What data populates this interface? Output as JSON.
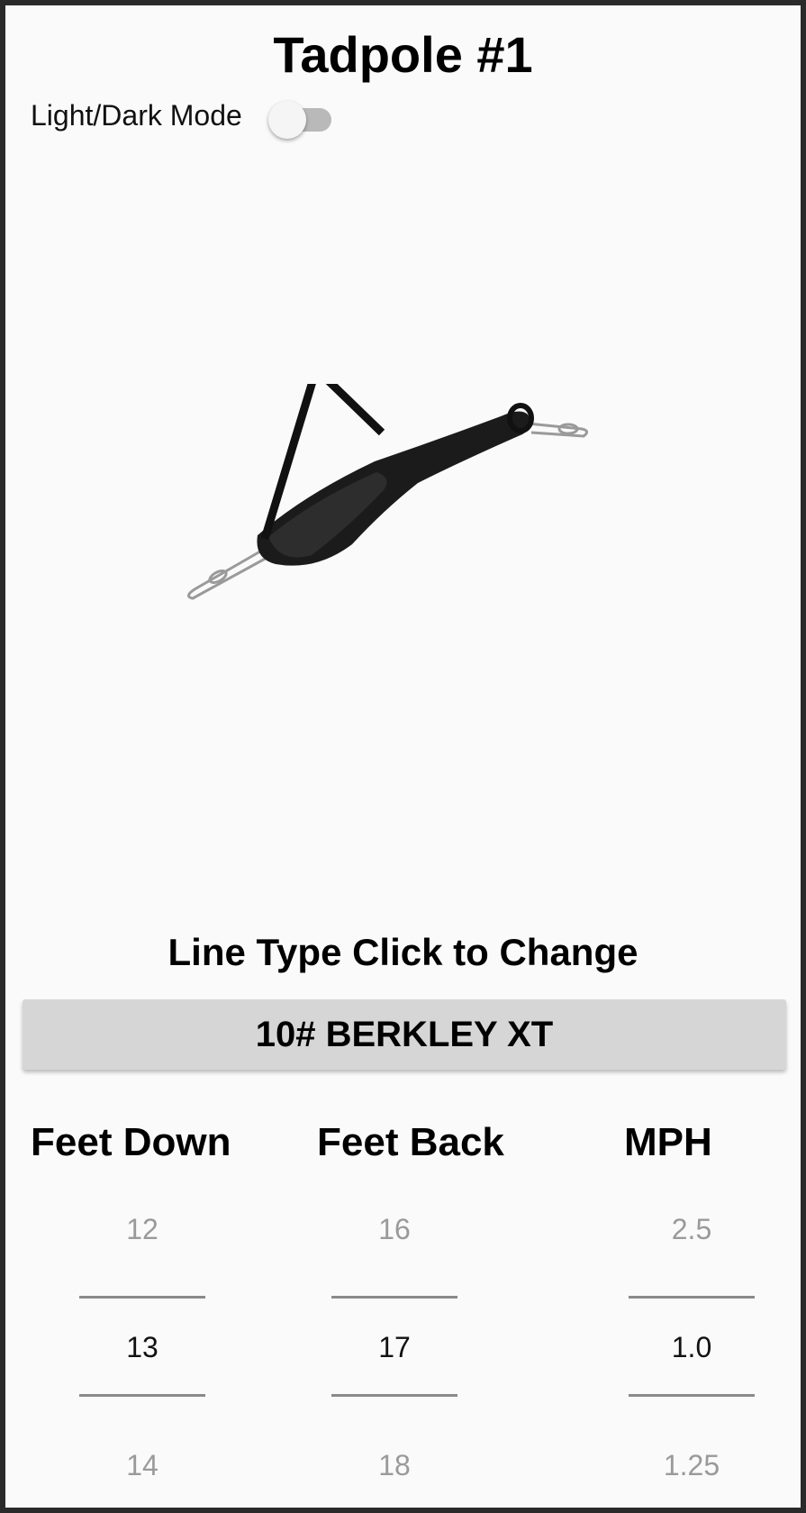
{
  "header": {
    "title": "Tadpole #1",
    "mode_label": "Light/Dark Mode",
    "dark_mode_on": false
  },
  "line_type": {
    "label": "Line Type Click to Change",
    "value": "10# BERKLEY XT",
    "button_color": "#d6d6d6"
  },
  "columns": {
    "feet_down": {
      "header": "Feet Down",
      "prev": "12",
      "current": "13",
      "next": "14"
    },
    "feet_back": {
      "header": "Feet Back",
      "prev": "16",
      "current": "17",
      "next": "18"
    },
    "mph": {
      "header": "MPH",
      "prev": "2.5",
      "current": "1.0",
      "next": "1.25"
    }
  }
}
